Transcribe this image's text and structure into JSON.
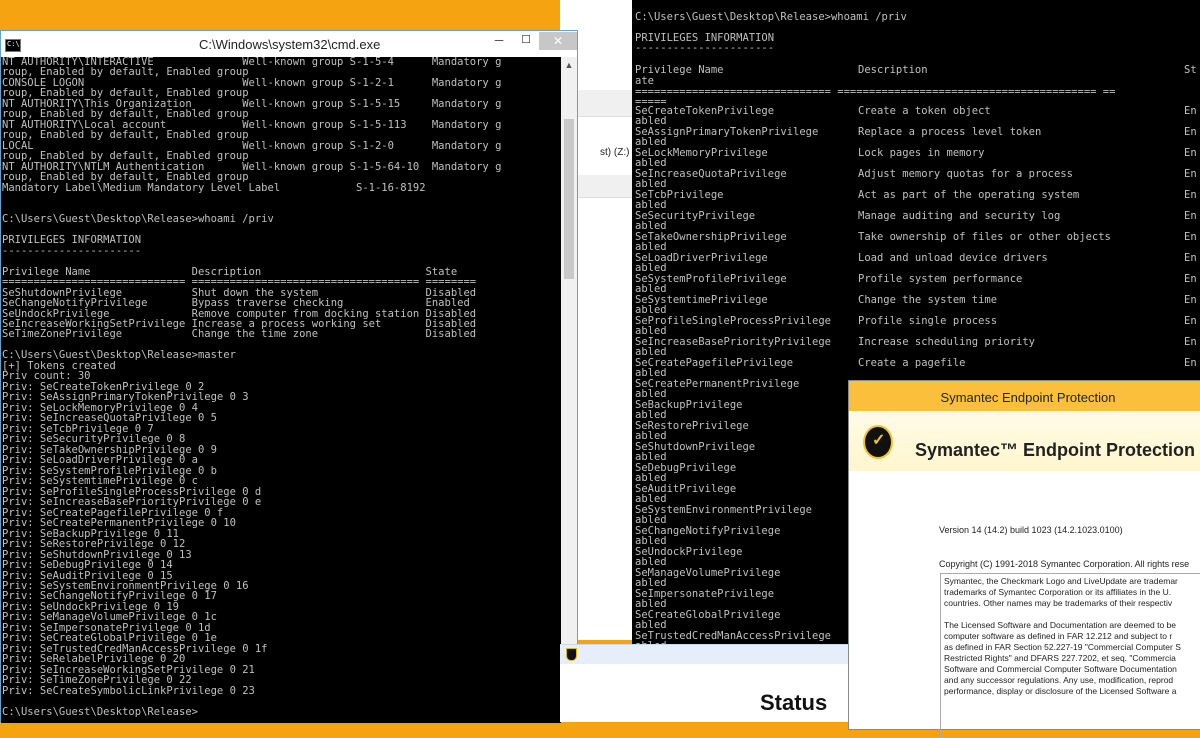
{
  "left_cmd": {
    "title": "C:\\Windows\\system32\\cmd.exe",
    "icon_text": "C:\\",
    "btn_min": "─",
    "btn_max": "☐",
    "btn_close": "✕",
    "lines": [
      "NT AUTHORITY\\INTERACTIVE              Well-known group S-1-5-4      Mandatory g",
      "roup, Enabled by default, Enabled group",
      "CONSOLE LOGON                         Well-known group S-1-2-1      Mandatory g",
      "roup, Enabled by default, Enabled group",
      "NT AUTHORITY\\This Organization        Well-known group S-1-5-15     Mandatory g",
      "roup, Enabled by default, Enabled group",
      "NT AUTHORITY\\Local account            Well-known group S-1-5-113    Mandatory g",
      "roup, Enabled by default, Enabled group",
      "LOCAL                                 Well-known group S-1-2-0      Mandatory g",
      "roup, Enabled by default, Enabled group",
      "NT AUTHORITY\\NTLM Authentication      Well-known group S-1-5-64-10  Mandatory g",
      "roup, Enabled by default, Enabled group",
      "Mandatory Label\\Medium Mandatory Level Label            S-1-16-8192",
      "",
      "",
      "C:\\Users\\Guest\\Desktop\\Release>whoami /priv",
      "",
      "PRIVILEGES INFORMATION",
      "----------------------",
      "",
      "Privilege Name                Description                          State",
      "============================= ==================================== ========",
      "SeShutdownPrivilege           Shut down the system                 Disabled",
      "SeChangeNotifyPrivilege       Bypass traverse checking             Enabled",
      "SeUndockPrivilege             Remove computer from docking station Disabled",
      "SeIncreaseWorkingSetPrivilege Increase a process working set       Disabled",
      "SeTimeZonePrivilege           Change the time zone                 Disabled",
      "",
      "C:\\Users\\Guest\\Desktop\\Release>master",
      "[+] Tokens created",
      "Priv count: 30",
      "Priv: SeCreateTokenPrivilege 0 2",
      "Priv: SeAssignPrimaryTokenPrivilege 0 3",
      "Priv: SeLockMemoryPrivilege 0 4",
      "Priv: SeIncreaseQuotaPrivilege 0 5",
      "Priv: SeTcbPrivilege 0 7",
      "Priv: SeSecurityPrivilege 0 8",
      "Priv: SeTakeOwnershipPrivilege 0 9",
      "Priv: SeLoadDriverPrivilege 0 a",
      "Priv: SeSystemProfilePrivilege 0 b",
      "Priv: SeSystemtimePrivilege 0 c",
      "Priv: SeProfileSingleProcessPrivilege 0 d",
      "Priv: SeIncreaseBasePriorityPrivilege 0 e",
      "Priv: SeCreatePagefilePrivilege 0 f",
      "Priv: SeCreatePermanentPrivilege 0 10",
      "Priv: SeBackupPrivilege 0 11",
      "Priv: SeRestorePrivilege 0 12",
      "Priv: SeShutdownPrivilege 0 13",
      "Priv: SeDebugPrivilege 0 14",
      "Priv: SeAuditPrivilege 0 15",
      "Priv: SeSystemEnvironmentPrivilege 0 16",
      "Priv: SeChangeNotifyPrivilege 0 17",
      "Priv: SeUndockPrivilege 0 19",
      "Priv: SeManageVolumePrivilege 0 1c",
      "Priv: SeImpersonatePrivilege 0 1d",
      "Priv: SeCreateGlobalPrivilege 0 1e",
      "Priv: SeTrustedCredManAccessPrivilege 0 1f",
      "Priv: SeRelabelPrivilege 0 20",
      "Priv: SeIncreaseWorkingSetPrivilege 0 21",
      "Priv: SeTimeZonePrivilege 0 22",
      "Priv: SeCreateSymbolicLinkPrivilege 0 23",
      "",
      "C:\\Users\\Guest\\Desktop\\Release>"
    ]
  },
  "right_cmd": {
    "prompt": "C:\\Users\\Guest\\Desktop\\Release>whoami /priv",
    "header": "PRIVILEGES INFORMATION",
    "underline": "----------------------",
    "col_name": "Privilege Name",
    "col_name_wrap": "ate",
    "col_desc": "Description",
    "col_state": "St",
    "sep_line": "=============================== ========================================= ==",
    "sep_wrap": "=====",
    "rows": [
      {
        "name": "SeCreateTokenPrivilege",
        "desc": "Create a token object",
        "state": "En"
      },
      {
        "name": "SeAssignPrimaryTokenPrivilege",
        "desc": "Replace a process level token",
        "state": "En"
      },
      {
        "name": "SeLockMemoryPrivilege",
        "desc": "Lock pages in memory",
        "state": "En"
      },
      {
        "name": "SeIncreaseQuotaPrivilege",
        "desc": "Adjust memory quotas for a process",
        "state": "En"
      },
      {
        "name": "SeTcbPrivilege",
        "desc": "Act as part of the operating system",
        "state": "En"
      },
      {
        "name": "SeSecurityPrivilege",
        "desc": "Manage auditing and security log",
        "state": "En"
      },
      {
        "name": "SeTakeOwnershipPrivilege",
        "desc": "Take ownership of files or other objects",
        "state": "En"
      },
      {
        "name": "SeLoadDriverPrivilege",
        "desc": "Load and unload device drivers",
        "state": "En"
      },
      {
        "name": "SeSystemProfilePrivilege",
        "desc": "Profile system performance",
        "state": "En"
      },
      {
        "name": "SeSystemtimePrivilege",
        "desc": "Change the system time",
        "state": "En"
      },
      {
        "name": "SeProfileSingleProcessPrivilege",
        "desc": "Profile single process",
        "state": "En"
      },
      {
        "name": "SeIncreaseBasePriorityPrivilege",
        "desc": "Increase scheduling priority",
        "state": "En"
      },
      {
        "name": "SeCreatePagefilePrivilege",
        "desc": "Create a pagefile",
        "state": "En"
      },
      {
        "name": "SeCreatePermanentPrivilege",
        "desc": "",
        "state": ""
      },
      {
        "name": "SeBackupPrivilege",
        "desc": "",
        "state": ""
      },
      {
        "name": "SeRestorePrivilege",
        "desc": "",
        "state": ""
      },
      {
        "name": "SeShutdownPrivilege",
        "desc": "",
        "state": ""
      },
      {
        "name": "SeDebugPrivilege",
        "desc": "",
        "state": ""
      },
      {
        "name": "SeAuditPrivilege",
        "desc": "",
        "state": ""
      },
      {
        "name": "SeSystemEnvironmentPrivilege",
        "desc": "",
        "state": ""
      },
      {
        "name": "SeChangeNotifyPrivilege",
        "desc": "",
        "state": ""
      },
      {
        "name": "SeUndockPrivilege",
        "desc": "",
        "state": ""
      },
      {
        "name": "SeManageVolumePrivilege",
        "desc": "",
        "state": ""
      },
      {
        "name": "SeImpersonatePrivilege",
        "desc": "",
        "state": ""
      },
      {
        "name": "SeCreateGlobalPrivilege",
        "desc": "",
        "state": ""
      },
      {
        "name": "SeTrustedCredManAccessPrivilege",
        "desc": "",
        "state": ""
      }
    ],
    "wrap_text": "abled"
  },
  "explorer": {
    "drive_label": "st) (Z:)  ▸"
  },
  "symantec": {
    "window_title": "Symantec Endpoint Protection",
    "logo_glyph": "✓",
    "product_name": "Symantec™ Endpoint Protection",
    "version": "Version 14 (14.2)  build 1023 (14.2.1023.0100)",
    "copyright": "Copyright (C) 1991-2018 Symantec Corporation. All rights rese",
    "legal": "Symantec, the Checkmark Logo and LiveUpdate are trademar\ntrademarks of Symantec Corporation or its affiliates in the U.\ncountries. Other names may be trademarks of their respectiv\n\nThe Licensed Software and Documentation are deemed to be\ncomputer software as defined in FAR 12.212 and subject to r\nas defined in FAR Section 52.227-19 \"Commercial Computer S\nRestricted Rights\" and DFARS 227.7202, et seq. \"Commercia\nSoftware and Commercial Computer Software Documentation\nand any successor regulations. Any use, modification, reprod\nperformance, display or disclosure of the Licensed Software a"
  },
  "status": {
    "label": "Status"
  },
  "colors": {
    "console_bg": "#000000",
    "console_fg": "#c0c0c0",
    "desktop": "#f5a310",
    "symantec_yellow": "#fcbf3c"
  }
}
